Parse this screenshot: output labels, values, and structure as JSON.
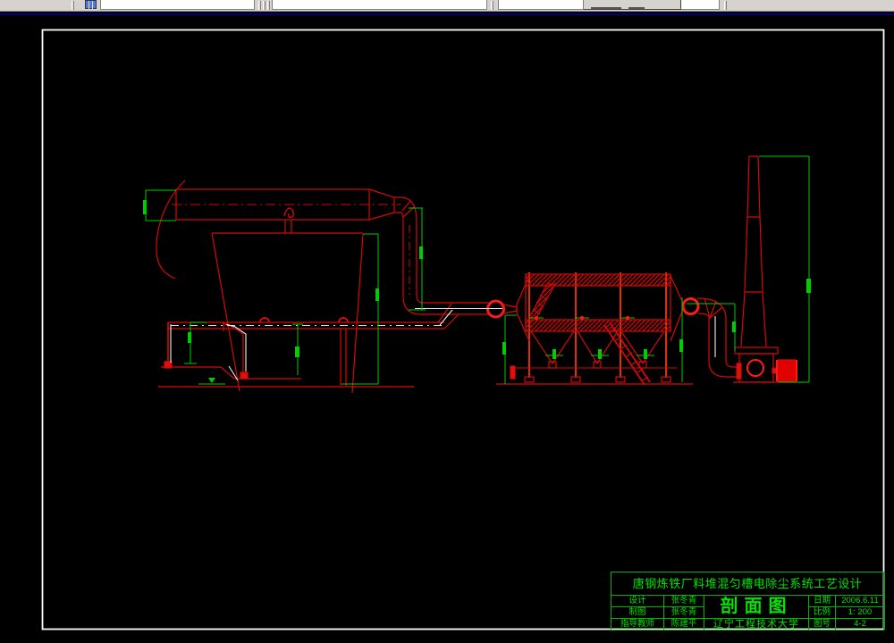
{
  "title_block": {
    "project_title": "唐钢炼铁厂料堆混匀槽电除尘系统工艺设计",
    "drawing_title": "剖面图",
    "org": "辽宁工程技术大学",
    "design_label": "设计",
    "design_value": "张冬青",
    "draft_label": "制图",
    "draft_value": "张冬青",
    "advisor_label": "指导教师",
    "advisor_value": "陈建平",
    "date_label": "日期",
    "date_value": "2006.6.11",
    "scale_label": "比例",
    "scale_value": "1: 200",
    "no_label": "图号",
    "no_value": "4-2"
  },
  "colors": {
    "line_red": "#d40909",
    "bright_red": "#ff1a1a",
    "dim_green": "#00cc00",
    "text_green": "#00e400",
    "frame_white": "#ffffff",
    "toolbar_gray": "#d6d3ce",
    "navy_band": "#000080"
  }
}
